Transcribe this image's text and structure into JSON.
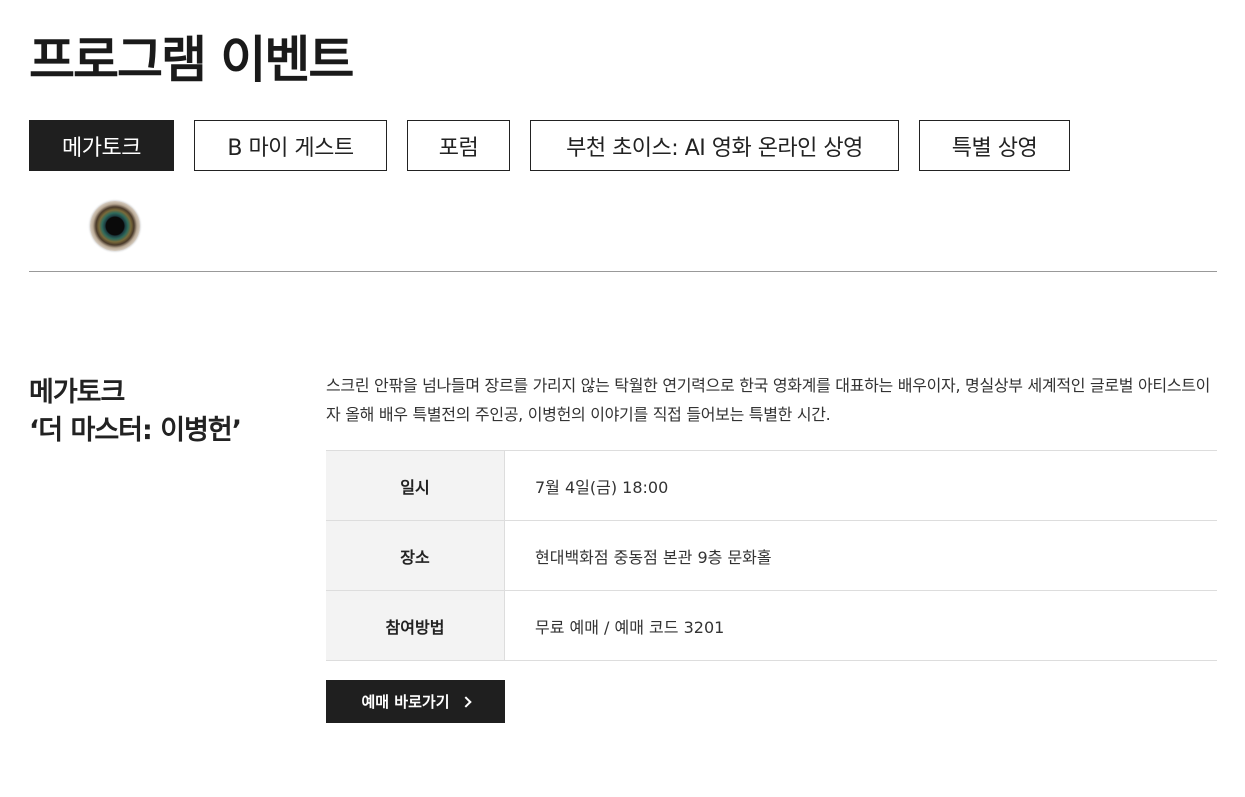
{
  "page": {
    "title": "프로그램 이벤트"
  },
  "tabs": [
    {
      "label": "메가토크",
      "active": true
    },
    {
      "label": "B 마이 게스트",
      "active": false
    },
    {
      "label": "포럼",
      "active": false
    },
    {
      "label": "부천 초이스: AI 영화 온라인 상영",
      "active": false
    },
    {
      "label": "특별 상영",
      "active": false
    }
  ],
  "event": {
    "title_line1": "메가토크",
    "title_line2": "‘더 마스터: 이병헌’",
    "description": "스크린 안팎을 넘나들며 장르를 가리지 않는 탁월한 연기력으로 한국 영화계를 대표하는 배우이자, 명실상부 세계적인 글로벌 아티스트이자 올해 배우 특별전의 주인공, 이병헌의 이야기를 직접 들어보는 특별한 시간.",
    "info": [
      {
        "label": "일시",
        "value": "7월 4일(금) 18:00"
      },
      {
        "label": "장소",
        "value": "현대백화점 중동점 본관 9층 문화홀"
      },
      {
        "label": "참여방법",
        "value": "무료 예매 / 예매 코드 3201"
      }
    ],
    "reserve_label": "예매 바로가기"
  },
  "icons": {
    "eye": "eye-icon",
    "chevron": "chevron-right-icon"
  },
  "colors": {
    "active_tab_bg": "#1f1f1f",
    "table_label_bg": "#f3f3f3"
  }
}
